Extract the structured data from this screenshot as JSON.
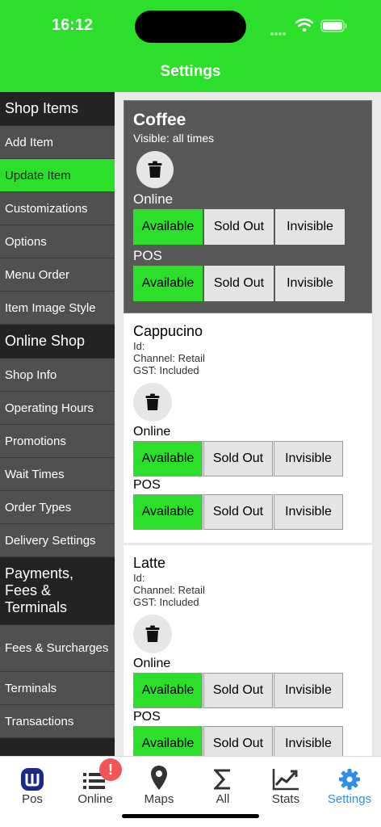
{
  "status": {
    "time": "16:12"
  },
  "header": {
    "title": "Settings"
  },
  "sidebar": {
    "groups": [
      {
        "title": "Shop Items",
        "items": [
          "Add Item",
          "Update Item",
          "Customizations",
          "Options",
          "Menu Order",
          "Item Image Style"
        ]
      },
      {
        "title": "Online Shop",
        "items": [
          "Shop Info",
          "Operating Hours",
          "Promotions",
          "Wait Times",
          "Order Types",
          "Delivery Settings"
        ]
      },
      {
        "title": "Payments, Fees & Terminals",
        "items": [
          "Fees & Surcharges",
          "Terminals",
          "Transactions"
        ]
      }
    ],
    "active_item": "Update Item"
  },
  "category": {
    "title": "Coffee",
    "visibility": "Visible: all times",
    "online_label": "Online",
    "pos_label": "POS",
    "buttons": [
      "Available",
      "Sold Out",
      "Invisible"
    ]
  },
  "items": [
    {
      "name": "Cappucino",
      "id": "Id:",
      "channel": "Channel: Retail",
      "gst": "GST: Included",
      "online_label": "Online",
      "pos_label": "POS",
      "buttons": [
        "Available",
        "Sold Out",
        "Invisible"
      ]
    },
    {
      "name": "Latte",
      "id": "Id:",
      "channel": "Channel: Retail",
      "gst": "GST: Included",
      "online_label": "Online",
      "pos_label": "POS",
      "buttons": [
        "Available",
        "Sold Out",
        "Invisible"
      ]
    }
  ],
  "tabs": [
    {
      "label": "Pos",
      "icon": "pos-logo-icon"
    },
    {
      "label": "Online",
      "icon": "list-icon",
      "badge": "!"
    },
    {
      "label": "Maps",
      "icon": "map-pin-icon"
    },
    {
      "label": "All",
      "icon": "sigma-icon"
    },
    {
      "label": "Stats",
      "icon": "chart-icon"
    },
    {
      "label": "Settings",
      "icon": "gear-icon"
    }
  ],
  "colors": {
    "accent": "#2bdf2b",
    "tab_active": "#2f8fe8",
    "badge": "#f25555"
  }
}
